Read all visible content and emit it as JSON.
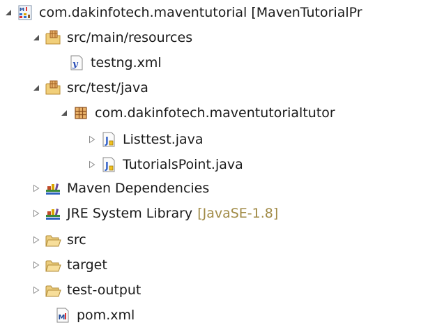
{
  "project_explorer": {
    "colors": {
      "label": "#1a1a1a",
      "decoration": "#a08a45",
      "twisty": "#7a7a7a"
    },
    "items": [
      {
        "label": "com.dakinfotech.maventutorial [MavenTutorialPr",
        "icon": "maven-project-icon",
        "expanded": true,
        "level": 0
      },
      {
        "label": "src/main/resources",
        "icon": "source-folder-icon",
        "expanded": true,
        "level": 1
      },
      {
        "label": "testng.xml",
        "icon": "xml-file-icon",
        "level": 2
      },
      {
        "label": "src/test/java",
        "icon": "source-folder-icon",
        "expanded": true,
        "level": 1
      },
      {
        "label": "com.dakinfotech.maventutorialtutor",
        "icon": "package-icon",
        "expanded": true,
        "level": 2
      },
      {
        "label": "Listtest.java",
        "icon": "java-file-icon",
        "expanded": false,
        "level": 3
      },
      {
        "label": "TutorialsPoint.java",
        "icon": "java-file-icon",
        "expanded": false,
        "level": 3
      },
      {
        "label": "Maven Dependencies",
        "icon": "library-icon",
        "expanded": false,
        "level": 1
      },
      {
        "label": "JRE System Library",
        "decoration": "[JavaSE-1.8]",
        "icon": "library-icon",
        "expanded": false,
        "level": 1
      },
      {
        "label": "src",
        "icon": "folder-icon",
        "expanded": false,
        "level": 1
      },
      {
        "label": "target",
        "icon": "folder-icon",
        "expanded": false,
        "level": 1
      },
      {
        "label": "test-output",
        "icon": "folder-icon",
        "expanded": false,
        "level": 1
      },
      {
        "label": "pom.xml",
        "icon": "maven-pom-icon",
        "level": 1
      }
    ]
  }
}
